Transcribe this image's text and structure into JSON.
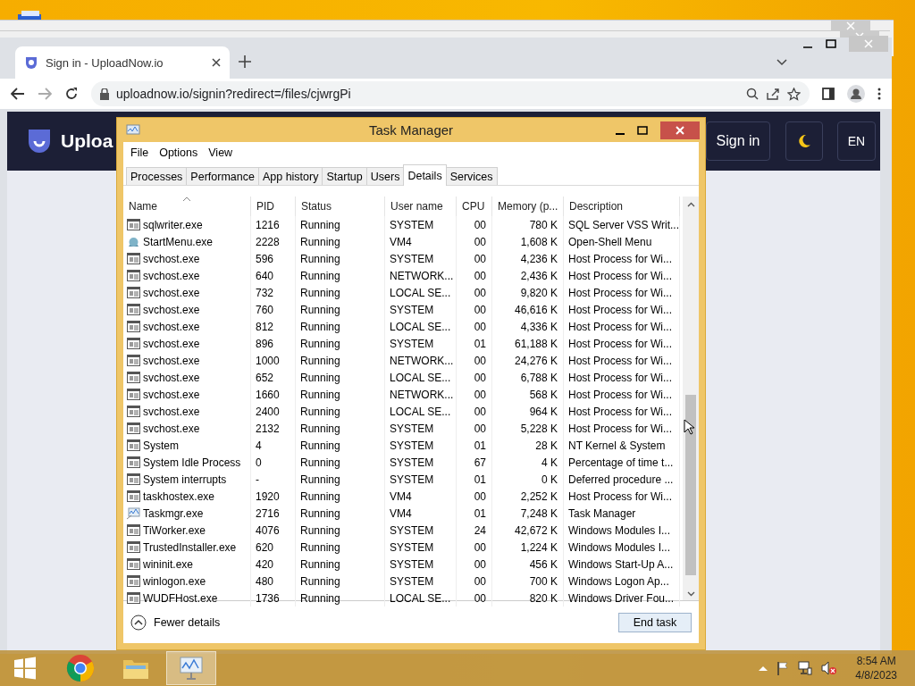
{
  "browser": {
    "tab_title": "Sign in - UploadNow.io",
    "url": "uploadnow.io/signin?redirect=/files/cjwrgPi"
  },
  "site_header": {
    "logo_text": "Uploa",
    "sign_in": "Sign in",
    "language": "EN"
  },
  "task_manager": {
    "title": "Task Manager",
    "menu": [
      "File",
      "Options",
      "View"
    ],
    "tabs": [
      {
        "label": "Processes",
        "selected": false
      },
      {
        "label": "Performance",
        "selected": false
      },
      {
        "label": "App history",
        "selected": false
      },
      {
        "label": "Startup",
        "selected": false
      },
      {
        "label": "Users",
        "selected": false
      },
      {
        "label": "Details",
        "selected": true
      },
      {
        "label": "Services",
        "selected": false
      }
    ],
    "columns": [
      {
        "label": "Name",
        "sorted": true
      },
      {
        "label": "PID",
        "sorted": false
      },
      {
        "label": "Status",
        "sorted": false
      },
      {
        "label": "User name",
        "sorted": false
      },
      {
        "label": "CPU",
        "sorted": false
      },
      {
        "label": "Memory (p...",
        "sorted": false
      },
      {
        "label": "Description",
        "sorted": false
      }
    ],
    "rows": [
      {
        "kind": "exe",
        "cells": [
          "sqlwriter.exe",
          "1216",
          "Running",
          "SYSTEM",
          "00",
          "780 K",
          "SQL Server VSS Writ..."
        ]
      },
      {
        "kind": "shell",
        "cells": [
          "StartMenu.exe",
          "2228",
          "Running",
          "VM4",
          "00",
          "1,608 K",
          "Open-Shell Menu"
        ]
      },
      {
        "kind": "exe",
        "cells": [
          "svchost.exe",
          "596",
          "Running",
          "SYSTEM",
          "00",
          "4,236 K",
          "Host Process for Wi..."
        ]
      },
      {
        "kind": "exe",
        "cells": [
          "svchost.exe",
          "640",
          "Running",
          "NETWORK...",
          "00",
          "2,436 K",
          "Host Process for Wi..."
        ]
      },
      {
        "kind": "exe",
        "cells": [
          "svchost.exe",
          "732",
          "Running",
          "LOCAL SE...",
          "00",
          "9,820 K",
          "Host Process for Wi..."
        ]
      },
      {
        "kind": "exe",
        "cells": [
          "svchost.exe",
          "760",
          "Running",
          "SYSTEM",
          "00",
          "46,616 K",
          "Host Process for Wi..."
        ]
      },
      {
        "kind": "exe",
        "cells": [
          "svchost.exe",
          "812",
          "Running",
          "LOCAL SE...",
          "00",
          "4,336 K",
          "Host Process for Wi..."
        ]
      },
      {
        "kind": "exe",
        "cells": [
          "svchost.exe",
          "896",
          "Running",
          "SYSTEM",
          "01",
          "61,188 K",
          "Host Process for Wi..."
        ]
      },
      {
        "kind": "exe",
        "cells": [
          "svchost.exe",
          "1000",
          "Running",
          "NETWORK...",
          "00",
          "24,276 K",
          "Host Process for Wi..."
        ]
      },
      {
        "kind": "exe",
        "cells": [
          "svchost.exe",
          "652",
          "Running",
          "LOCAL SE...",
          "00",
          "6,788 K",
          "Host Process for Wi..."
        ]
      },
      {
        "kind": "exe",
        "cells": [
          "svchost.exe",
          "1660",
          "Running",
          "NETWORK...",
          "00",
          "568 K",
          "Host Process for Wi..."
        ]
      },
      {
        "kind": "exe",
        "cells": [
          "svchost.exe",
          "2400",
          "Running",
          "LOCAL SE...",
          "00",
          "964 K",
          "Host Process for Wi..."
        ]
      },
      {
        "kind": "exe",
        "cells": [
          "svchost.exe",
          "2132",
          "Running",
          "SYSTEM",
          "00",
          "5,228 K",
          "Host Process for Wi..."
        ]
      },
      {
        "kind": "exe",
        "cells": [
          "System",
          "4",
          "Running",
          "SYSTEM",
          "01",
          "28 K",
          "NT Kernel & System"
        ]
      },
      {
        "kind": "exe",
        "cells": [
          "System Idle Process",
          "0",
          "Running",
          "SYSTEM",
          "67",
          "4 K",
          "Percentage of time t..."
        ]
      },
      {
        "kind": "exe",
        "cells": [
          "System interrupts",
          "-",
          "Running",
          "SYSTEM",
          "01",
          "0 K",
          "Deferred procedure ..."
        ]
      },
      {
        "kind": "exe",
        "cells": [
          "taskhostex.exe",
          "1920",
          "Running",
          "VM4",
          "00",
          "2,252 K",
          "Host Process for Wi..."
        ]
      },
      {
        "kind": "taskmgr",
        "cells": [
          "Taskmgr.exe",
          "2716",
          "Running",
          "VM4",
          "01",
          "7,248 K",
          "Task Manager"
        ]
      },
      {
        "kind": "exe",
        "cells": [
          "TiWorker.exe",
          "4076",
          "Running",
          "SYSTEM",
          "24",
          "42,672 K",
          "Windows Modules I..."
        ]
      },
      {
        "kind": "exe",
        "cells": [
          "TrustedInstaller.exe",
          "620",
          "Running",
          "SYSTEM",
          "00",
          "1,224 K",
          "Windows Modules I..."
        ]
      },
      {
        "kind": "exe",
        "cells": [
          "wininit.exe",
          "420",
          "Running",
          "SYSTEM",
          "00",
          "456 K",
          "Windows Start-Up A..."
        ]
      },
      {
        "kind": "exe",
        "cells": [
          "winlogon.exe",
          "480",
          "Running",
          "SYSTEM",
          "00",
          "700 K",
          "Windows Logon Ap..."
        ]
      },
      {
        "kind": "exe",
        "cells": [
          "WUDFHost.exe",
          "1736",
          "Running",
          "LOCAL SE...",
          "00",
          "820 K",
          "Windows Driver Fou..."
        ]
      }
    ],
    "fewer_details": "Fewer details",
    "end_task": "End task"
  },
  "taskbar": {
    "apps": [
      {
        "kind": "chrome",
        "selected": false
      },
      {
        "kind": "explorer",
        "selected": false
      },
      {
        "kind": "taskmgr",
        "selected": true
      }
    ],
    "time": "8:54 AM",
    "date": "4/8/2023"
  }
}
